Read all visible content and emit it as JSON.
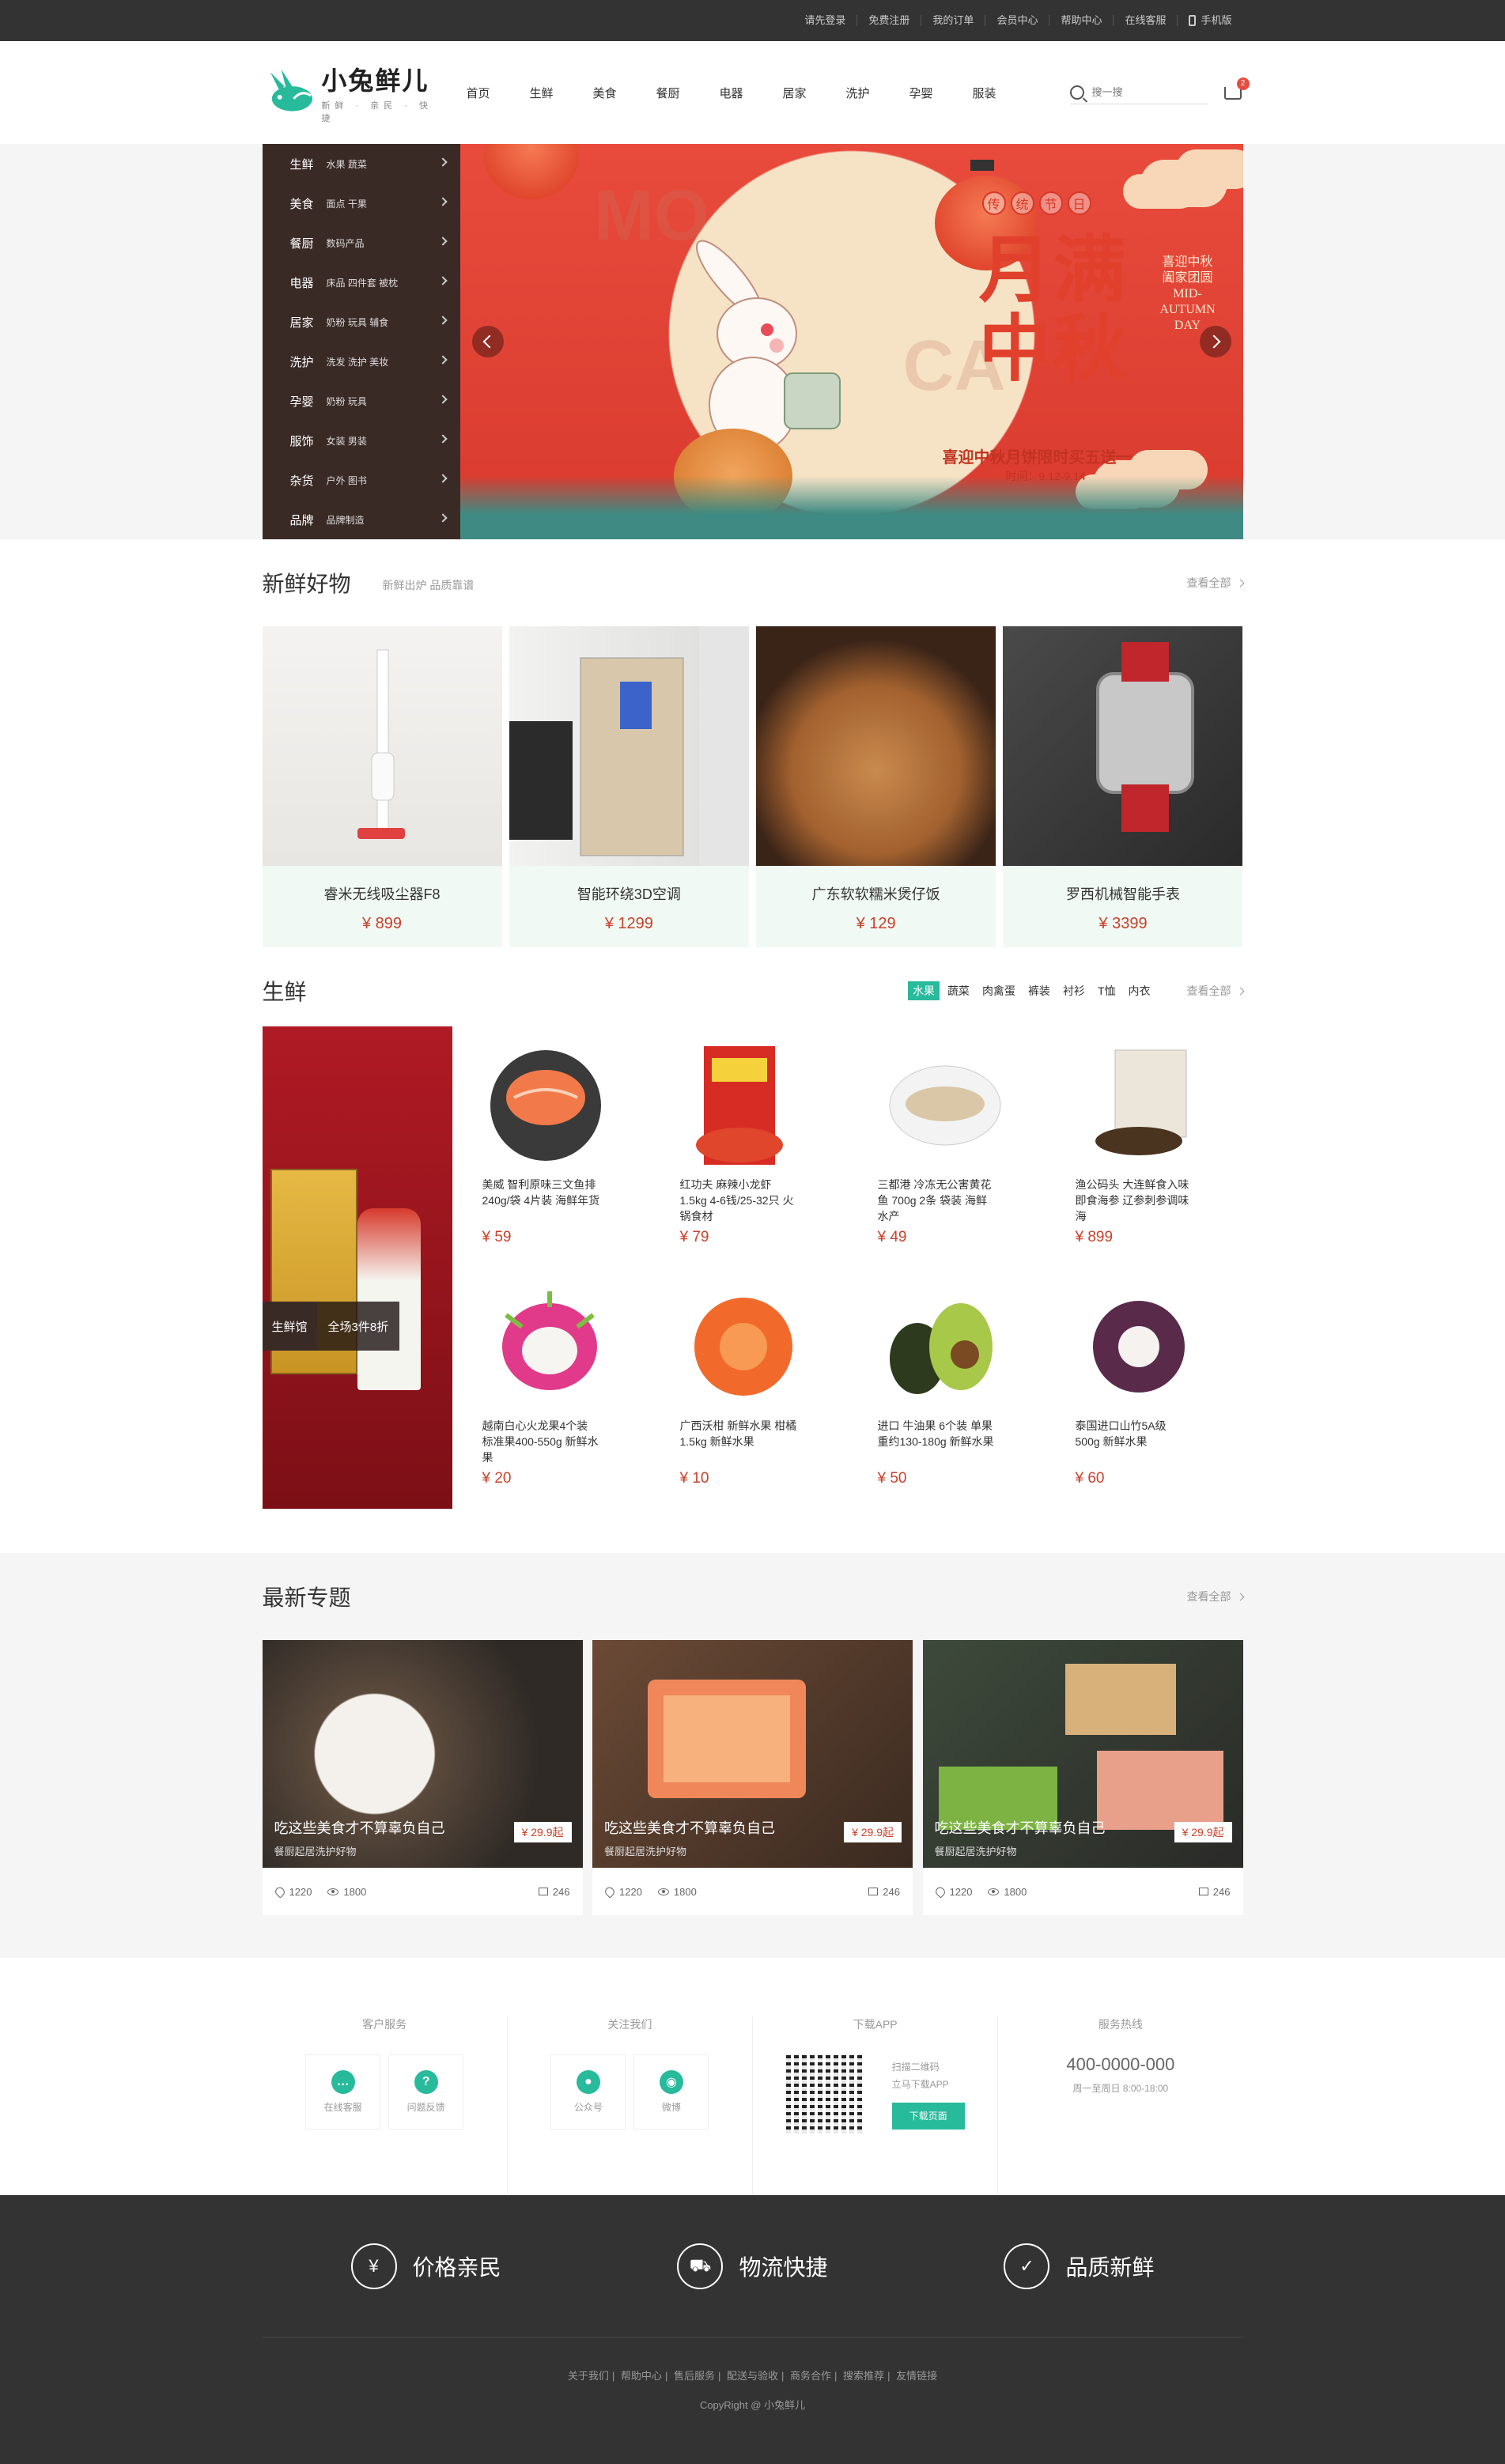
{
  "topbar": {
    "links": [
      "请先登录",
      "免费注册",
      "我的订单",
      "会员中心",
      "帮助中心",
      "在线客服",
      "手机版"
    ]
  },
  "header": {
    "logo_title": "小兔鲜儿",
    "logo_sub": "新鲜 · 亲民 · 快捷",
    "nav": [
      "首页",
      "生鲜",
      "美食",
      "餐厨",
      "电器",
      "居家",
      "洗护",
      "孕婴",
      "服装"
    ],
    "search_placeholder": "搜一搜",
    "cart_count": "2"
  },
  "categories": [
    {
      "main": "生鲜",
      "sub": "水果 蔬菜"
    },
    {
      "main": "美食",
      "sub": "面点 干果"
    },
    {
      "main": "餐厨",
      "sub": "数码产品"
    },
    {
      "main": "电器",
      "sub": "床品 四件套 被枕"
    },
    {
      "main": "居家",
      "sub": "奶粉 玩具 辅食"
    },
    {
      "main": "洗护",
      "sub": "洗发 洗护 美妆"
    },
    {
      "main": "孕婴",
      "sub": "奶粉 玩具"
    },
    {
      "main": "服饰",
      "sub": "女装 男装"
    },
    {
      "main": "杂货",
      "sub": "户外 图书"
    },
    {
      "main": "品牌",
      "sub": "品牌制造"
    }
  ],
  "banner": {
    "tags": [
      "传",
      "统",
      "节",
      "日"
    ],
    "title_line1": "月满",
    "title_line2": "中秋",
    "promo": "喜迎中秋月饼限时买五送一",
    "time": "时间：9.12-9.14",
    "side_text": "喜迎中秋 阖家团圆 MID- AUTUMN DAY",
    "bg_text1": "MO",
    "bg_text2": "CA"
  },
  "new_goods": {
    "title": "新鲜好物",
    "sub": "新鲜出炉 品质靠谱",
    "view_all": "查看全部",
    "items": [
      {
        "name": "睿米无线吸尘器F8",
        "price": "¥ 899"
      },
      {
        "name": "智能环绕3D空调",
        "price": "¥ 1299"
      },
      {
        "name": "广东软软糯米煲仔饭",
        "price": "¥ 129"
      },
      {
        "name": "罗西机械智能手表",
        "price": "¥ 3399"
      }
    ]
  },
  "fresh": {
    "title": "生鲜",
    "tabs": [
      "水果",
      "蔬菜",
      "肉禽蛋",
      "裤装",
      "衬衫",
      "T恤",
      "内衣"
    ],
    "view_all": "查看全部",
    "promo_tag": "生鲜馆",
    "promo_text": "全场3件8折",
    "items": [
      {
        "name": "美威 智利原味三文鱼排 240g/袋 4片装 海鲜年货",
        "price": "¥ 59"
      },
      {
        "name": "红功夫 麻辣小龙虾 1.5kg 4-6钱/25-32只 火锅食材",
        "price": "¥ 79"
      },
      {
        "name": "三都港 冷冻无公害黄花鱼 700g 2条 袋装 海鲜水产",
        "price": "¥ 49"
      },
      {
        "name": "渔公码头 大连鲜食入味 即食海参 辽参刺参调味海",
        "price": "¥ 899"
      },
      {
        "name": "越南白心火龙果4个装 标准果400-550g 新鲜水果",
        "price": "¥ 20"
      },
      {
        "name": "广西沃柑 新鲜水果 柑橘1.5kg 新鲜水果",
        "price": "¥ 10"
      },
      {
        "name": "进口 牛油果 6个装 单果重约130-180g 新鲜水果",
        "price": "¥ 50"
      },
      {
        "name": "泰国进口山竹5A级 500g 新鲜水果",
        "price": "¥ 60"
      }
    ]
  },
  "topics": {
    "title": "最新专题",
    "view_all": "查看全部",
    "items": [
      {
        "title": "吃这些美食才不算辜负自己",
        "sub": "餐厨起居洗护好物",
        "price": "¥ 29.9起",
        "likes": "1220",
        "views": "1800",
        "comments": "246"
      },
      {
        "title": "吃这些美食才不算辜负自己",
        "sub": "餐厨起居洗护好物",
        "price": "¥ 29.9起",
        "likes": "1220",
        "views": "1800",
        "comments": "246"
      },
      {
        "title": "吃这些美食才不算辜负自己",
        "sub": "餐厨起居洗护好物",
        "price": "¥ 29.9起",
        "likes": "1220",
        "views": "1800",
        "comments": "246"
      }
    ]
  },
  "service": {
    "cs_title": "客户服务",
    "cs_boxes": [
      "在线客服",
      "问题反馈"
    ],
    "follow_title": "关注我们",
    "follow_boxes": [
      "公众号",
      "微博"
    ],
    "app_title": "下载APP",
    "app_line1": "扫描二维码",
    "app_line2": "立马下载APP",
    "app_btn": "下载页面",
    "hotline_title": "服务热线",
    "hotline": "400-0000-000",
    "hotline_sub": "周一至周日 8:00-18:00"
  },
  "footer": {
    "promises": [
      "价格亲民",
      "物流快捷",
      "品质新鲜"
    ],
    "links": [
      "关于我们",
      "帮助中心",
      "售后服务",
      "配送与验收",
      "商务合作",
      "搜索推荐",
      "友情链接"
    ],
    "copyright": "CopyRight @ 小兔鲜儿"
  },
  "colors": {
    "accent": "#27ba9b",
    "price": "#c9412a",
    "dark": "#333333"
  }
}
